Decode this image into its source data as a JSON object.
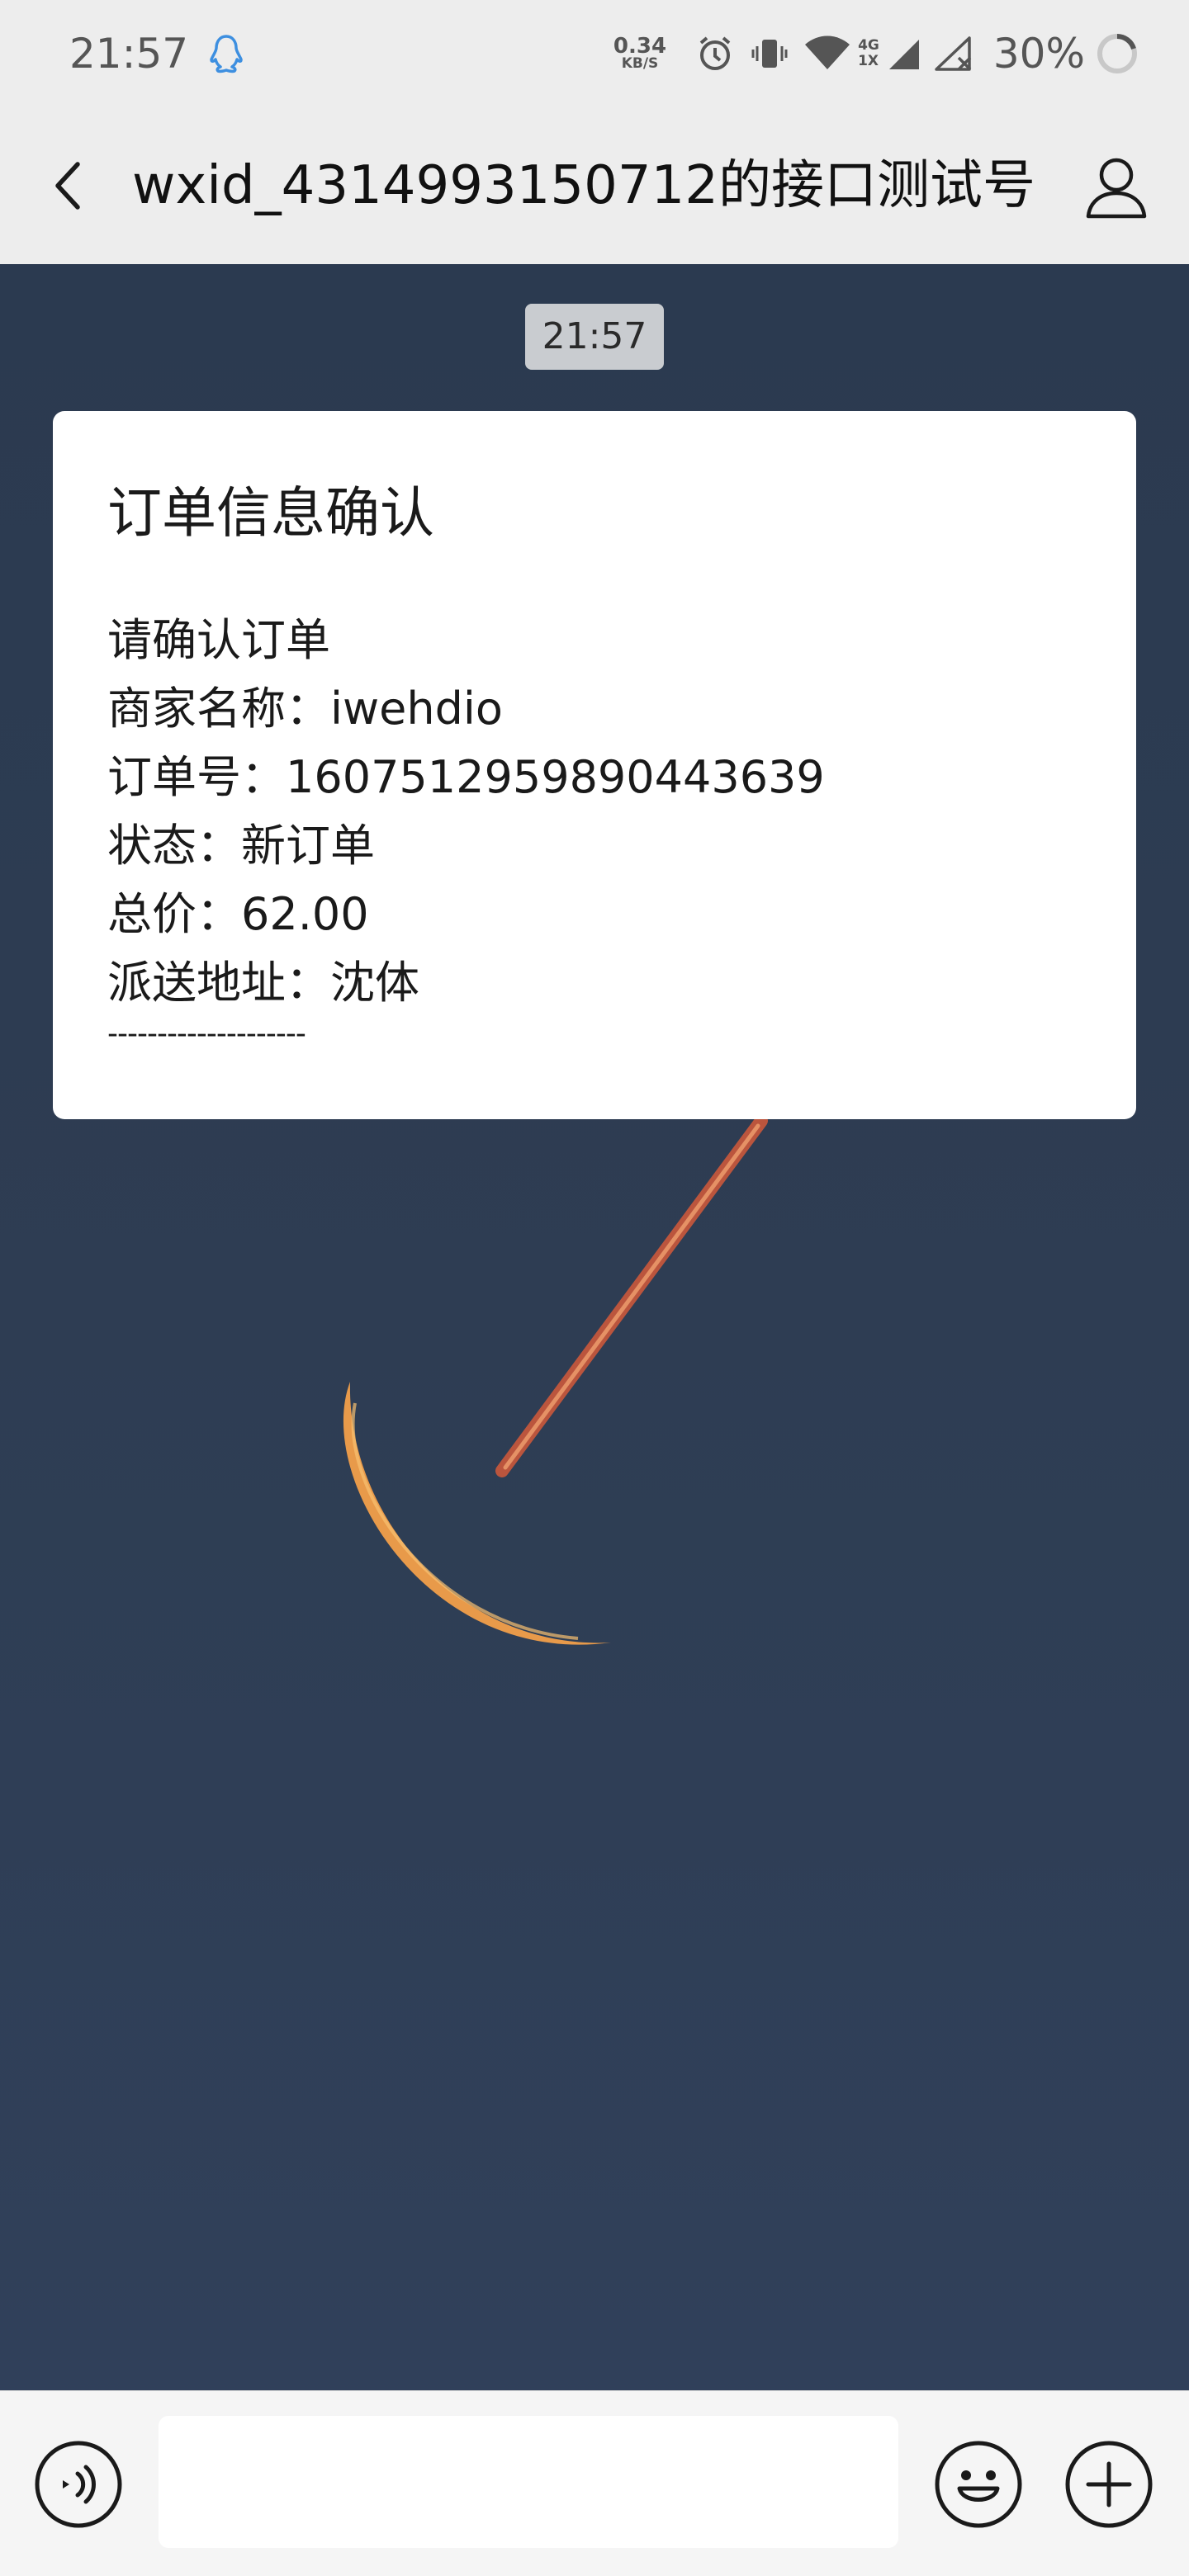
{
  "status_bar": {
    "time": "21:57",
    "net_speed_value": "0.34",
    "net_speed_unit": "KB/S",
    "network_type_top": "4G",
    "network_type_bottom": "1X",
    "battery_text": "30%"
  },
  "header": {
    "title": "wxid_4314993150712的接口测试号"
  },
  "chat": {
    "timestamp": "21:57",
    "message": {
      "title": "订单信息确认",
      "lines": [
        "请确认订单",
        "商家名称：iwehdio",
        "订单号：1607512959890443639",
        "状态：新订单",
        "总价：62.00",
        "派送地址：沈体"
      ],
      "divider": "--------------------"
    }
  },
  "input_bar": {
    "text_value": ""
  },
  "icons": {
    "status_qq": "qq-penguin-icon",
    "alarm": "alarm-icon",
    "vibrate": "vibrate-icon",
    "wifi": "wifi-icon",
    "signal": "signal-icon",
    "signal_no_service": "no-signal-icon",
    "battery": "battery-ring-icon",
    "back": "chevron-left-icon",
    "profile": "person-icon",
    "voice": "voice-icon",
    "emoji": "emoji-icon",
    "more": "plus-circle-icon"
  },
  "colors": {
    "bar_background": "#ededed",
    "chat_background": "#2d3c52",
    "qq_blue": "#3d8fe0",
    "moon_orange": "#e89a4a",
    "contrail_red": "#d45a3a"
  }
}
